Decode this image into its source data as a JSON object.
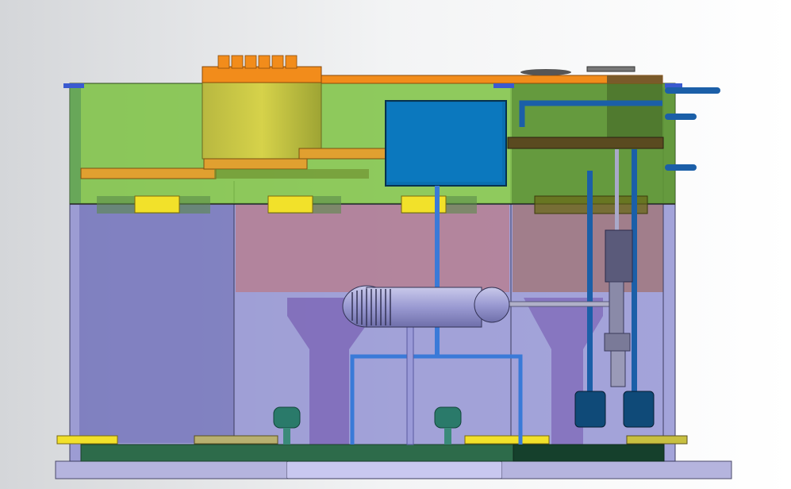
{
  "scene": {
    "background": [
      "#d4d6d9",
      "#f3f4f5",
      "#ffffff"
    ],
    "colors": {
      "upper_tank": "#7cc242",
      "lower_tank": "#8a8ad0",
      "lid_orange": "#f28c1b",
      "cylinder_yellow": "#c7c63c",
      "brackets_yellow": "#f2e12a",
      "control_box_blue": "#0a6fb0",
      "pipe_blue": "#1b5fa8",
      "plinth_green": "#2d6b4a",
      "base_grey": "#a9a8d6",
      "funnel_purple": "#6b4aa8",
      "filter_pink": "#b87b8a"
    },
    "components": {
      "upper_tank": "upper-tank",
      "lower_tank": "lower-tank",
      "lid": "lid-plate",
      "cylinder": "drum-cylinder",
      "control_box": "control-box",
      "uv_lamp": "uv-lamp-housing",
      "pumps": "submersible-pumps",
      "float_valves": "float-valves",
      "base": "base-frame"
    }
  }
}
